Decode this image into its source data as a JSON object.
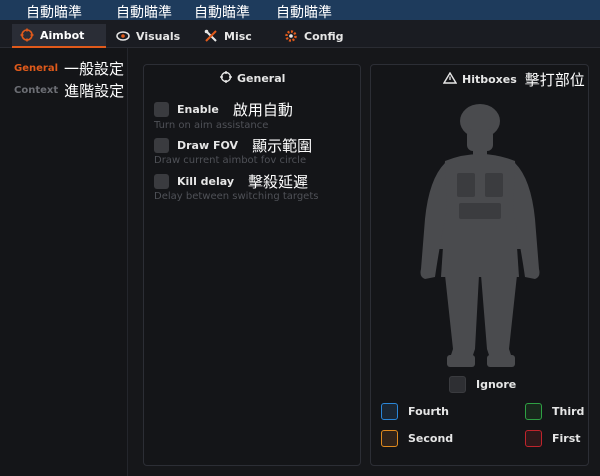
{
  "annotations": [
    "自動瞄準",
    "自動瞄準",
    "自動瞄準",
    "自動瞄準"
  ],
  "tabs": [
    {
      "label": "Aimbot",
      "icon": "crosshair-icon",
      "active": true
    },
    {
      "label": "Visuals",
      "icon": "eye-icon",
      "active": false
    },
    {
      "label": "Misc",
      "icon": "tools-icon",
      "active": false
    },
    {
      "label": "Config",
      "icon": "gear-icon",
      "active": false
    }
  ],
  "sidebar": {
    "items": [
      {
        "label": "General",
        "translation": "一般設定",
        "active": true
      },
      {
        "label": "Context",
        "translation": "進階設定",
        "active": false
      }
    ]
  },
  "general": {
    "title": "General",
    "options": [
      {
        "label": "Enable",
        "translation": "啟用自動",
        "description": "Turn on aim assistance",
        "checked": false
      },
      {
        "label": "Draw FOV",
        "translation": "顯示範圍",
        "description": "Draw current aimbot fov circle",
        "checked": false
      },
      {
        "label": "Kill delay",
        "translation": "擊殺延遲",
        "description": "Delay between switching targets",
        "checked": false
      }
    ]
  },
  "hitboxes": {
    "title": "Hitboxes",
    "translation": "擊打部位",
    "ignore_label": "Ignore",
    "entries": [
      {
        "label": "Fourth",
        "color": "#2a86d8"
      },
      {
        "label": "Third",
        "color": "#2ea043"
      },
      {
        "label": "Second",
        "color": "#e08a1e"
      },
      {
        "label": "First",
        "color": "#c0242c"
      }
    ]
  },
  "colors": {
    "accent": "#e05a1b",
    "background": "#16171a",
    "panel": "#141518"
  }
}
